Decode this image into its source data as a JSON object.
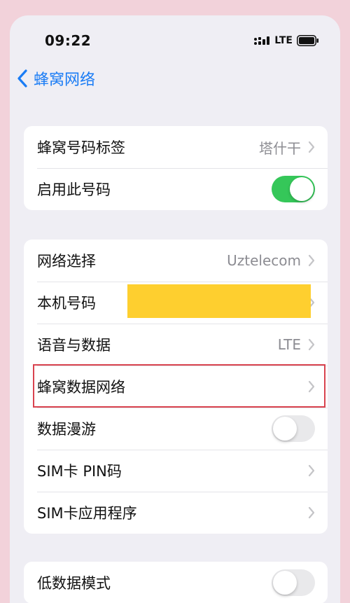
{
  "status_bar": {
    "time": "09:22",
    "network_type": "LTE",
    "icons": [
      "signal-icon",
      "battery-icon"
    ]
  },
  "nav": {
    "back_label": "蜂窝网络",
    "back_icon": "chevron-left-icon"
  },
  "groups": [
    {
      "rows": [
        {
          "label": "蜂窝号码标签",
          "value": "塔什干",
          "accessory": "chevron"
        },
        {
          "label": "启用此号码",
          "accessory": "toggle",
          "toggle_on": true
        }
      ]
    },
    {
      "rows": [
        {
          "label": "网络选择",
          "value": "Uztelecom",
          "accessory": "chevron"
        },
        {
          "label": "本机号码",
          "value": "",
          "accessory": "chevron"
        },
        {
          "label": "语音与数据",
          "value": "LTE",
          "accessory": "chevron"
        },
        {
          "label": "蜂窝数据网络",
          "accessory": "chevron",
          "highlighted": true
        },
        {
          "label": "数据漫游",
          "accessory": "toggle",
          "toggle_on": false
        },
        {
          "label": "SIM卡 PIN码",
          "accessory": "chevron"
        },
        {
          "label": "SIM卡应用程序",
          "accessory": "chevron"
        }
      ]
    },
    {
      "rows": [
        {
          "label": "低数据模式",
          "accessory": "toggle",
          "toggle_on": false
        }
      ]
    }
  ],
  "colors": {
    "background": "#f2d2da",
    "screen": "#efeef4",
    "accent_blue": "#1a7cf5",
    "toggle_green": "#35c759",
    "redaction_yellow": "#fecf2f",
    "highlight_red": "#d9434f"
  }
}
